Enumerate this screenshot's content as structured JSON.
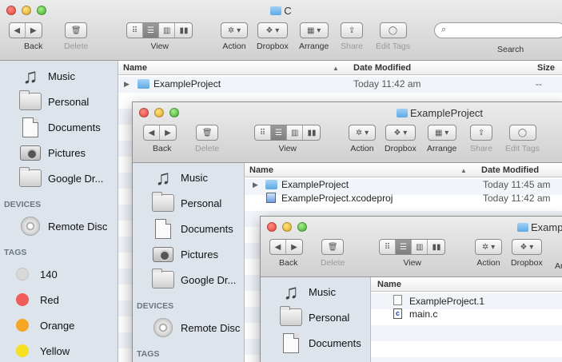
{
  "toolbar": {
    "back": "Back",
    "delete": "Delete",
    "view": "View",
    "action": "Action",
    "dropbox": "Dropbox",
    "arrange": "Arrange",
    "share": "Share",
    "edit_tags": "Edit Tags",
    "search": "Search"
  },
  "glyphs": {
    "back": "◀",
    "forward": "▶",
    "trash": "🗑",
    "icon_view": "⠿",
    "list_view": "☰",
    "column_view": "▥",
    "coverflow": "▮▮",
    "gear": "✲ ▾",
    "dropbox": "❖ ▾",
    "arrange": "▦ ▾",
    "share": "⇪",
    "tag": "◯",
    "search_mag": "⌕",
    "disclosure": "▶",
    "sort_asc": "▲"
  },
  "sidebar": {
    "favorites": [
      "Music",
      "Personal",
      "Documents",
      "Pictures",
      "Google Dr..."
    ],
    "devices_header": "DEVICES",
    "devices": [
      "Remote Disc"
    ],
    "tags_header": "TAGS",
    "tags": [
      {
        "label": "140",
        "color": "#d9d9d9"
      },
      {
        "label": "Red",
        "color": "#f05b5b"
      },
      {
        "label": "Orange",
        "color": "#f6a623"
      },
      {
        "label": "Yellow",
        "color": "#f7e022"
      }
    ]
  },
  "columns": {
    "name": "Name",
    "date_modified": "Date Modified",
    "size": "Size"
  },
  "window1": {
    "title": "C",
    "rows": [
      {
        "name": "ExampleProject",
        "date": "Today 11:42 am",
        "size": "--"
      }
    ]
  },
  "window2": {
    "title": "ExampleProject",
    "rows": [
      {
        "name": "ExampleProject",
        "date": "Today 11:45 am"
      },
      {
        "name": "ExampleProject.xcodeproj",
        "date": "Today 11:42 am"
      }
    ]
  },
  "window3": {
    "title": "Example",
    "toolbar_partial_label": "Ar",
    "rows": [
      {
        "name": "ExampleProject.1"
      },
      {
        "name": "main.c"
      }
    ]
  },
  "colors": {
    "sidebar_bg": "#dde4ec",
    "accent_folder": "#5fa8e0",
    "row_stripe": "#f1f5fa"
  }
}
